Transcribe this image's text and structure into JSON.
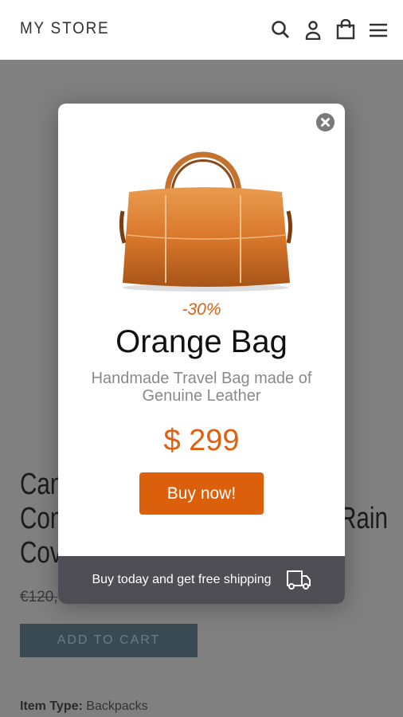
{
  "header": {
    "logo": "MY STORE",
    "icons": [
      "search-icon",
      "account-icon",
      "bag-icon",
      "menu-icon"
    ]
  },
  "background": {
    "title_fragments": [
      "Can",
      "Con",
      "Rain",
      "Cov"
    ],
    "old_price_fragment": "€120,",
    "add_to_cart": "ADD TO CART",
    "item_type_label": "Item Type:",
    "item_type_value": "Backpacks"
  },
  "modal": {
    "discount": "-30%",
    "title": "Orange Bag",
    "subtitle": "Handmade Travel Bag made of Genuine Leather",
    "price": "$ 299",
    "button": "Buy now!",
    "footer_text": "Buy today and get free shipping",
    "footer_icon": "truck-icon",
    "accent": "#dc5f0c"
  }
}
